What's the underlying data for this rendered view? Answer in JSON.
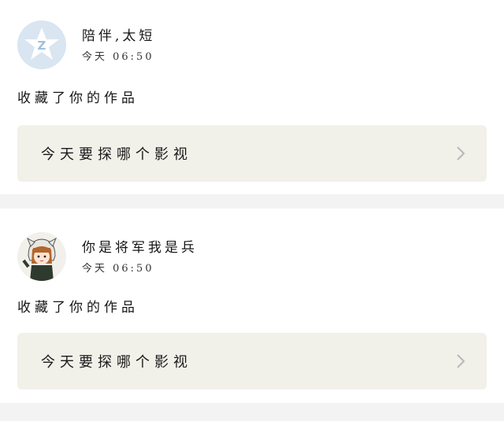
{
  "posts": [
    {
      "user_name": "陪伴,太短",
      "time": "今天 06:50",
      "action": "收藏了你的作品",
      "link_title": "今天要探哪个影视",
      "avatar_icon": "star-avatar-icon",
      "accent": "#dbe6f1"
    },
    {
      "user_name": "你是将军我是兵",
      "time": "今天 06:50",
      "action": "收藏了你的作品",
      "link_title": "今天要探哪个影视",
      "avatar_icon": "cartoon-girl-avatar-icon",
      "accent": "#f2f1ec"
    }
  ]
}
